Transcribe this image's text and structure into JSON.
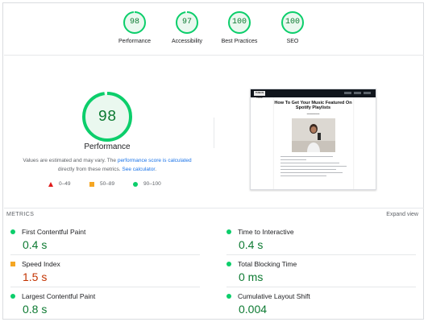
{
  "categories": [
    {
      "score": "98",
      "label": "Performance"
    },
    {
      "score": "97",
      "label": "Accessibility"
    },
    {
      "score": "100",
      "label": "Best Practices"
    },
    {
      "score": "100",
      "label": "SEO"
    }
  ],
  "performance": {
    "score": "98",
    "title": "Performance",
    "note_prefix": "Values are estimated and may vary. The",
    "note_link": "performance score is calculated",
    "note_middle": "directly from these metrics.",
    "note_calc": "See calculator",
    "note_end": "."
  },
  "legend": [
    {
      "range": "0–49",
      "color": "#e01b1b"
    },
    {
      "range": "50–89",
      "color": "#f5a623"
    },
    {
      "range": "90–100",
      "color": "#0cce6b"
    }
  ],
  "thumbnail": {
    "logo": "TUNE IN LOUD",
    "article_title": "How To Get Your Music Featured On Spotify Playlists"
  },
  "metrics": {
    "heading": "METRICS",
    "expand": "Expand view",
    "items": [
      {
        "name": "First Contentful Paint",
        "value": "0.4 s",
        "status": "good"
      },
      {
        "name": "Time to Interactive",
        "value": "0.4 s",
        "status": "good"
      },
      {
        "name": "Speed Index",
        "value": "1.5 s",
        "status": "average"
      },
      {
        "name": "Total Blocking Time",
        "value": "0 ms",
        "status": "good"
      },
      {
        "name": "Largest Contentful Paint",
        "value": "0.8 s",
        "status": "good"
      },
      {
        "name": "Cumulative Layout Shift",
        "value": "0.004",
        "status": "good"
      }
    ]
  },
  "colors": {
    "good": "#0cce6b",
    "good_text": "#0d7a32",
    "average": "#f5a623",
    "average_text": "#c33300",
    "poor": "#e01b1b"
  }
}
